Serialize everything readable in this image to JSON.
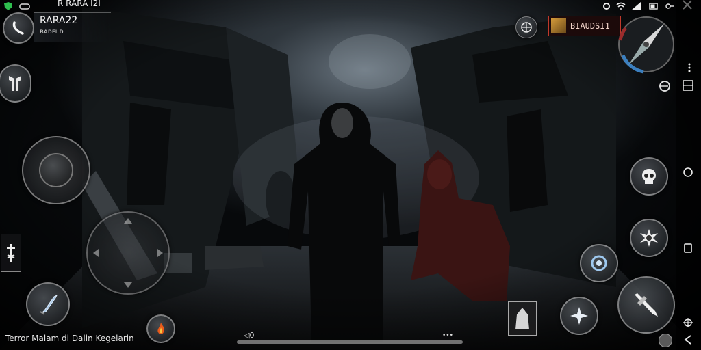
{
  "player": {
    "name": "RARA22",
    "sub": "ʙᴀᴅᴇı ᴅ"
  },
  "statusbar": {
    "title": "R RARA I2I"
  },
  "currency": {
    "label": "BIAUDSI1"
  },
  "footer": {
    "title": "Terror Malam di Dalin Kegelarin",
    "media": "◁0",
    "dots": "•••"
  },
  "colors": {
    "accent_red": "#c0392b",
    "compass_red": "#9b2c2c",
    "compass_blue": "#3b7fbf",
    "ui_gray": "#c8c8c8"
  },
  "icons": {
    "back": "back-arrow-icon",
    "class": "warrior-class-icon",
    "joystick": "joystick-icon",
    "side": "side-menu-icon",
    "sword": "sword-icon",
    "fire": "campfire-icon",
    "globe": "globe-icon",
    "compass": "compass-icon",
    "skull": "skull-icon",
    "burst": "burst-skill-icon",
    "shield": "shield-ring-icon",
    "star": "star-skill-icon",
    "attack": "dagger-attack-icon",
    "item": "cloak-item-icon"
  }
}
